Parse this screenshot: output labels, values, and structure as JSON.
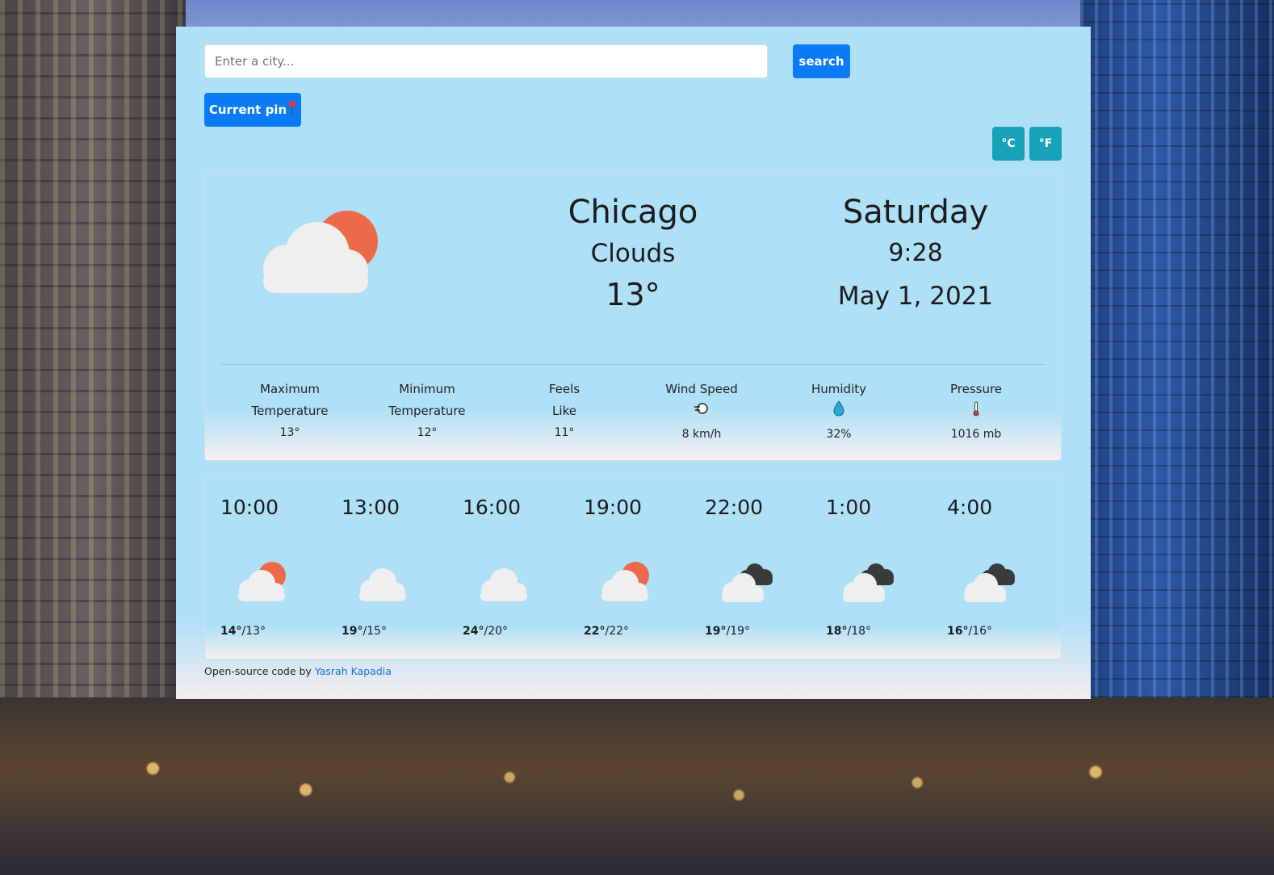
{
  "search": {
    "placeholder": "Enter a city...",
    "button_label": "search"
  },
  "pin_button_label": "Current pin",
  "units": {
    "celsius": "°C",
    "fahrenheit": "°F"
  },
  "current": {
    "icon": "cloud-sun-icon",
    "city": "Chicago",
    "condition": "Clouds",
    "temp": "13°",
    "day": "Saturday",
    "time": "9:28",
    "date": "May 1, 2021"
  },
  "stats": [
    {
      "label_line1": "Maximum",
      "label_line2": "Temperature",
      "value": "13°",
      "icon": ""
    },
    {
      "label_line1": "Minimum",
      "label_line2": "Temperature",
      "value": "12°",
      "icon": ""
    },
    {
      "label_line1": "Feels",
      "label_line2": "Like",
      "value": "11°",
      "icon": ""
    },
    {
      "label_line1": "Wind Speed",
      "label_line2": "",
      "value": "8 km/h",
      "icon": "wind-icon"
    },
    {
      "label_line1": "Humidity",
      "label_line2": "",
      "value": "32%",
      "icon": "droplet-icon"
    },
    {
      "label_line1": "Pressure",
      "label_line2": "",
      "value": "1016 mb",
      "icon": "thermometer-icon"
    }
  ],
  "forecast": [
    {
      "time": "10:00",
      "icon": "cloud-sun-icon",
      "high": "14°",
      "low": "/13°"
    },
    {
      "time": "13:00",
      "icon": "cloud-icon",
      "high": "19°",
      "low": "/15°"
    },
    {
      "time": "16:00",
      "icon": "cloud-icon",
      "high": "24°",
      "low": "/20°"
    },
    {
      "time": "19:00",
      "icon": "cloud-sun-icon",
      "high": "22°",
      "low": "/22°"
    },
    {
      "time": "22:00",
      "icon": "dark-clouds-icon",
      "high": "19°",
      "low": "/19°"
    },
    {
      "time": "1:00",
      "icon": "dark-clouds-icon",
      "high": "18°",
      "low": "/18°"
    },
    {
      "time": "4:00",
      "icon": "dark-clouds-icon",
      "high": "16°",
      "low": "/16°"
    }
  ],
  "footer": {
    "text": "Open-source code by ",
    "author": "Yasrah Kapadia"
  },
  "colors": {
    "panel": "#aee0f7",
    "primary_button": "#0b7bf5",
    "unit_button": "#17a2b8",
    "sun": "#ec6a4a",
    "cloud": "#efefef",
    "dark_cloud": "#3a3a3a",
    "link": "#1a6fd1"
  }
}
